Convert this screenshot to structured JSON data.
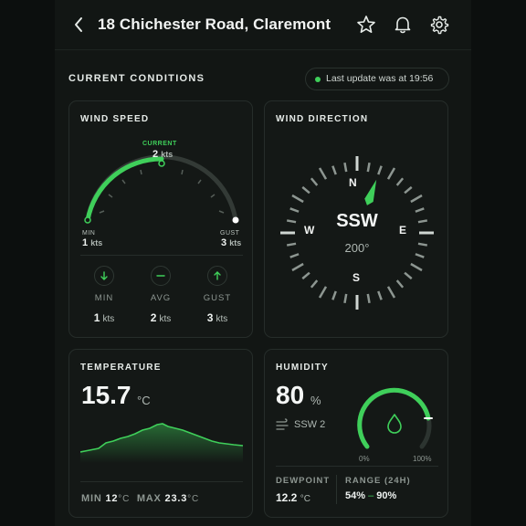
{
  "header": {
    "title": "18 Chichester Road, Claremont"
  },
  "conditions": {
    "section_title": "CURRENT CONDITIONS",
    "last_update": "Last update was at 19:56"
  },
  "wind_speed": {
    "title": "WIND SPEED",
    "current_label": "CURRENT",
    "current_value": "2",
    "current_unit": "kts",
    "min_label": "MIN",
    "min_value": "1",
    "min_unit": "kts",
    "gust_label": "GUST",
    "gust_value": "3",
    "gust_unit": "kts",
    "stats": [
      {
        "label": "MIN",
        "value": "1",
        "unit": "kts"
      },
      {
        "label": "AVG",
        "value": "2",
        "unit": "kts"
      },
      {
        "label": "GUST",
        "value": "3",
        "unit": "kts"
      }
    ]
  },
  "wind_direction": {
    "title": "WIND DIRECTION",
    "direction": "SSW",
    "degrees": "200°",
    "n": "N",
    "e": "E",
    "s": "S",
    "w": "W"
  },
  "temperature": {
    "title": "TEMPERATURE",
    "value": "15.7",
    "unit": "°C",
    "min_label": "MIN",
    "min_value": "12",
    "max_label": "MAX",
    "max_value": "23.3",
    "unit_small": "°C"
  },
  "humidity": {
    "title": "HUMIDITY",
    "value": "80",
    "unit": "%",
    "wind": "SSW 2",
    "gauge_min": "0%",
    "gauge_max": "100%",
    "dewpoint_label": "DEWPOINT",
    "dewpoint_value": "12.2",
    "dewpoint_unit": "°C",
    "range_label": "RANGE (24H)",
    "range_low": "54%",
    "range_sep": "–",
    "range_high": "90%"
  },
  "colors": {
    "accent": "#3fcf5a",
    "background": "#121614",
    "card": "#141816"
  }
}
